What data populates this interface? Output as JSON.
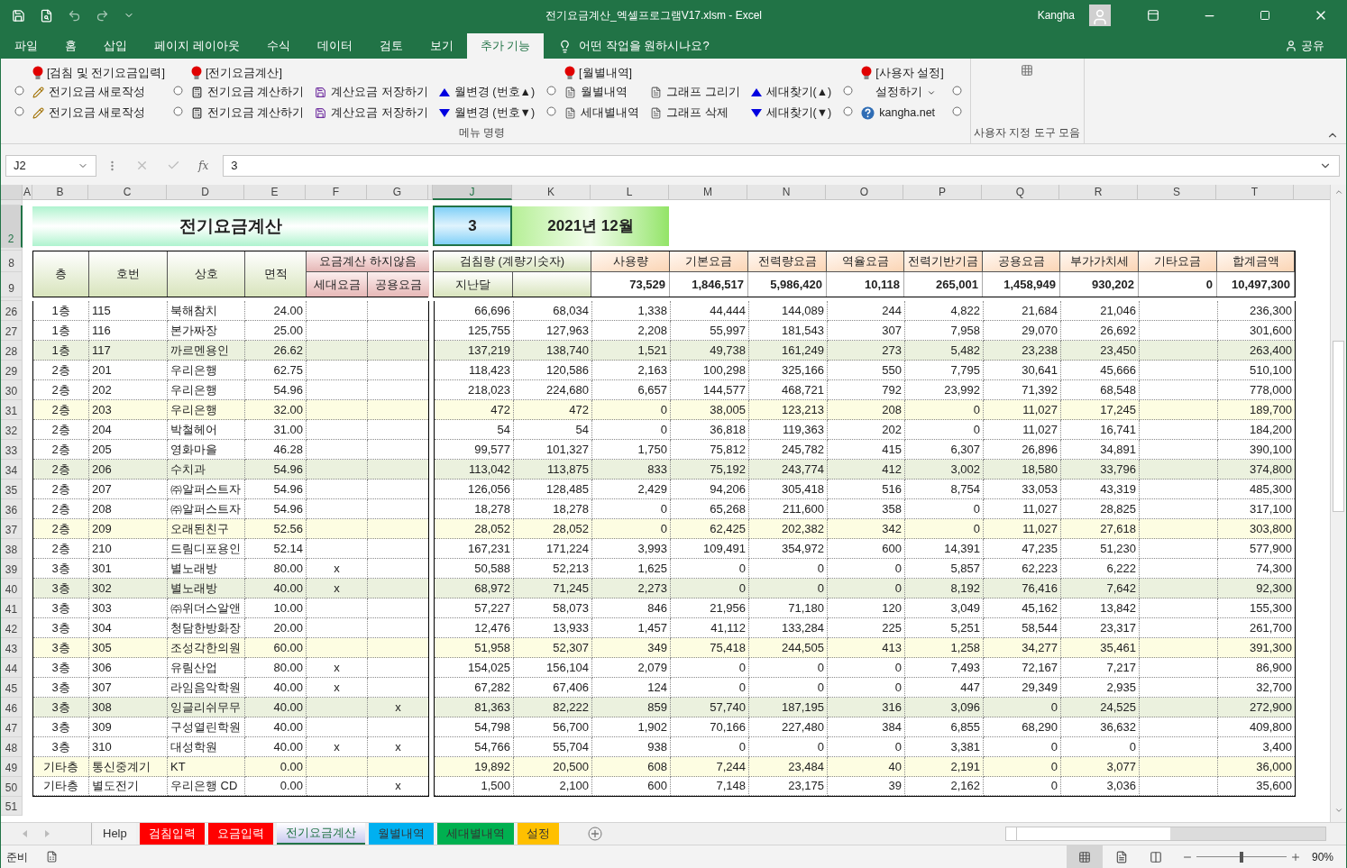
{
  "window": {
    "title": "전기요금계산_엑셀프로그램V17.xlsm  -  Excel",
    "user": "Kangha"
  },
  "ribbon_tabs": [
    {
      "label": "파일",
      "selected": false
    },
    {
      "label": "홈",
      "selected": false
    },
    {
      "label": "삽입",
      "selected": false
    },
    {
      "label": "페이지 레이아웃",
      "selected": false
    },
    {
      "label": "수식",
      "selected": false
    },
    {
      "label": "데이터",
      "selected": false
    },
    {
      "label": "검토",
      "selected": false
    },
    {
      "label": "보기",
      "selected": false
    },
    {
      "label": "추가 기능",
      "selected": true
    }
  ],
  "tell_me": "어떤 작업을 원하시나요?",
  "share": "공유",
  "ribbon": {
    "group_label": "메뉴 명령",
    "toolbar_label": "사용자 지정 도구 모음",
    "columns": [
      {
        "kind": "radios"
      },
      {
        "kind": "buttons",
        "header": "[검침 및 전기요금입력]",
        "items": [
          {
            "kind": "pencil",
            "label": "전기요금 새로작성"
          },
          {
            "kind": "pencil",
            "label": "전기요금 새로작성"
          }
        ]
      },
      {
        "kind": "radios"
      },
      {
        "kind": "buttons",
        "header": "[전기요금계산]",
        "items": [
          {
            "kind": "calculator",
            "label": "전기요금 계산하기"
          },
          {
            "kind": "calculator",
            "label": "전기요금 계산하기"
          }
        ]
      },
      {
        "kind": "buttons",
        "items": [
          {
            "kind": "save",
            "label": "계산요금 저장하기"
          },
          {
            "kind": "save",
            "label": "계산요금 저장하기"
          }
        ]
      },
      {
        "kind": "buttons",
        "items": [
          {
            "kind": "up",
            "label": "월변경 (번호▲)"
          },
          {
            "kind": "down",
            "label": "월변경 (번호▼)"
          }
        ]
      },
      {
        "kind": "radios"
      },
      {
        "kind": "buttons",
        "header": "[월별내역]",
        "items": [
          {
            "kind": "doc",
            "label": "월별내역"
          },
          {
            "kind": "doc",
            "label": "세대별내역"
          }
        ]
      },
      {
        "kind": "buttons",
        "items": [
          {
            "kind": "doc",
            "label": "그래프 그리기"
          },
          {
            "kind": "doc",
            "label": "그래프 삭제"
          }
        ]
      },
      {
        "kind": "buttons",
        "items": [
          {
            "kind": "up",
            "label": "세대찾기(▲)"
          },
          {
            "kind": "down",
            "label": "세대찾기(▼)"
          }
        ]
      },
      {
        "kind": "radios"
      },
      {
        "kind": "buttons",
        "header": "[사용자 설정]",
        "items": [
          {
            "kind": "dropdown",
            "label": "설정하기"
          },
          {
            "kind": "help",
            "label": "kangha.net"
          }
        ]
      },
      {
        "kind": "radios"
      }
    ]
  },
  "formula_bar": {
    "name_box": "J2",
    "function_label": "fx",
    "value": "3"
  },
  "columns": [
    {
      "label": "A",
      "selected": false
    },
    {
      "label": "B",
      "selected": false
    },
    {
      "label": "C",
      "selected": false
    },
    {
      "label": "D",
      "selected": false
    },
    {
      "label": "E",
      "selected": false
    },
    {
      "label": "F",
      "selected": false
    },
    {
      "label": "G",
      "selected": false
    },
    {
      "label": "J",
      "selected": true
    },
    {
      "label": "K",
      "selected": false
    },
    {
      "label": "L",
      "selected": false
    },
    {
      "label": "M",
      "selected": false
    },
    {
      "label": "N",
      "selected": false
    },
    {
      "label": "O",
      "selected": false
    },
    {
      "label": "P",
      "selected": false
    },
    {
      "label": "Q",
      "selected": false
    },
    {
      "label": "R",
      "selected": false
    },
    {
      "label": "S",
      "selected": false
    },
    {
      "label": "T",
      "selected": false
    }
  ],
  "title_row": {
    "row": "2",
    "selected": true,
    "title": "전기요금계산",
    "active_cell": "3",
    "month": "2021년 12월"
  },
  "header": {
    "rows": [
      "8",
      "9"
    ],
    "left": [
      "층",
      "호번",
      "상호",
      "면적"
    ],
    "exclude": "요금계산 하지않음",
    "exclude_sub": [
      "세대요금",
      "공용요금"
    ],
    "meter": "검침량 (계량기숫자)",
    "last_month": "지난달",
    "columns": [
      {
        "label": "사용량",
        "total": "73,529"
      },
      {
        "label": "기본요금",
        "total": "1,846,517"
      },
      {
        "label": "전력량요금",
        "total": "5,986,420"
      },
      {
        "label": "역율요금",
        "total": "10,118"
      },
      {
        "label": "전력기반기금",
        "total": "265,001"
      },
      {
        "label": "공용요금",
        "total": "1,458,949"
      },
      {
        "label": "부가가치세",
        "total": "930,202"
      },
      {
        "label": "기타요금",
        "total": "0"
      },
      {
        "label": "합계금액",
        "total": "10,497,300"
      }
    ]
  },
  "rows": [
    {
      "row": "26",
      "selected": false,
      "color": "#ffffff",
      "floor": "1층",
      "unit": "115",
      "name": "북해참치",
      "area": "24.00",
      "values": [
        "66,696",
        "68,034",
        "1,338",
        "44,444",
        "144,089",
        "244",
        "4,822",
        "21,684",
        "21,046"
      ],
      "total": "236,300"
    },
    {
      "row": "27",
      "selected": false,
      "color": "#ffffff",
      "floor": "1층",
      "unit": "116",
      "name": "본가짜장",
      "area": "25.00",
      "values": [
        "125,755",
        "127,963",
        "2,208",
        "55,997",
        "181,543",
        "307",
        "7,958",
        "29,070",
        "26,692"
      ],
      "total": "301,600"
    },
    {
      "row": "28",
      "selected": false,
      "color": "#ebf1de",
      "floor": "1층",
      "unit": "117",
      "name": "까르멘용인",
      "area": "26.62",
      "values": [
        "137,219",
        "138,740",
        "1,521",
        "49,738",
        "161,249",
        "273",
        "5,482",
        "23,238",
        "23,450"
      ],
      "total": "263,400"
    },
    {
      "row": "29",
      "selected": false,
      "color": "#ffffff",
      "floor": "2층",
      "unit": "201",
      "name": "우리은행",
      "area": "62.75",
      "values": [
        "118,423",
        "120,586",
        "2,163",
        "100,298",
        "325,166",
        "550",
        "7,795",
        "30,641",
        "45,666"
      ],
      "total": "510,100"
    },
    {
      "row": "30",
      "selected": false,
      "color": "#ffffff",
      "floor": "2층",
      "unit": "202",
      "name": "우리은행",
      "area": "54.96",
      "values": [
        "218,023",
        "224,680",
        "6,657",
        "144,577",
        "468,721",
        "792",
        "23,992",
        "71,392",
        "68,548"
      ],
      "total": "778,000"
    },
    {
      "row": "31",
      "selected": false,
      "color": "#fdfde2",
      "floor": "2층",
      "unit": "203",
      "name": "우리은행",
      "area": "32.00",
      "values": [
        "472",
        "472",
        "0",
        "38,005",
        "123,213",
        "208",
        "0",
        "11,027",
        "17,245"
      ],
      "total": "189,700"
    },
    {
      "row": "32",
      "selected": false,
      "color": "#ffffff",
      "floor": "2층",
      "unit": "204",
      "name": "박철헤어",
      "area": "31.00",
      "values": [
        "54",
        "54",
        "0",
        "36,818",
        "119,363",
        "202",
        "0",
        "11,027",
        "16,741"
      ],
      "total": "184,200"
    },
    {
      "row": "33",
      "selected": false,
      "color": "#ffffff",
      "floor": "2층",
      "unit": "205",
      "name": "영화마을",
      "area": "46.28",
      "values": [
        "99,577",
        "101,327",
        "1,750",
        "75,812",
        "245,782",
        "415",
        "6,307",
        "26,896",
        "34,891"
      ],
      "total": "390,100"
    },
    {
      "row": "34",
      "selected": false,
      "color": "#ebf1de",
      "floor": "2층",
      "unit": "206",
      "name": "수치과",
      "area": "54.96",
      "values": [
        "113,042",
        "113,875",
        "833",
        "75,192",
        "243,774",
        "412",
        "3,002",
        "18,580",
        "33,796"
      ],
      "total": "374,800"
    },
    {
      "row": "35",
      "selected": false,
      "color": "#ffffff",
      "floor": "2층",
      "unit": "207",
      "name": "㈜알퍼스트자",
      "area": "54.96",
      "values": [
        "126,056",
        "128,485",
        "2,429",
        "94,206",
        "305,418",
        "516",
        "8,754",
        "33,053",
        "43,319"
      ],
      "total": "485,300"
    },
    {
      "row": "36",
      "selected": false,
      "color": "#ffffff",
      "floor": "2층",
      "unit": "208",
      "name": "㈜알퍼스트자",
      "area": "54.96",
      "values": [
        "18,278",
        "18,278",
        "0",
        "65,268",
        "211,600",
        "358",
        "0",
        "11,027",
        "28,825"
      ],
      "total": "317,100"
    },
    {
      "row": "37",
      "selected": false,
      "color": "#fdfde2",
      "floor": "2층",
      "unit": "209",
      "name": "오래된친구",
      "area": "52.56",
      "values": [
        "28,052",
        "28,052",
        "0",
        "62,425",
        "202,382",
        "342",
        "0",
        "11,027",
        "27,618"
      ],
      "total": "303,800"
    },
    {
      "row": "38",
      "selected": false,
      "color": "#ffffff",
      "floor": "2층",
      "unit": "210",
      "name": "드림디포용인",
      "area": "52.14",
      "values": [
        "167,231",
        "171,224",
        "3,993",
        "109,491",
        "354,972",
        "600",
        "14,391",
        "47,235",
        "51,230"
      ],
      "total": "577,900"
    },
    {
      "row": "39",
      "selected": false,
      "color": "#ffffff",
      "floor": "3층",
      "unit": "301",
      "name": "별노래방",
      "area": "80.00",
      "no_unit_fee": "x",
      "values": [
        "50,588",
        "52,213",
        "1,625",
        "0",
        "0",
        "0",
        "5,857",
        "62,223",
        "6,222"
      ],
      "total": "74,300"
    },
    {
      "row": "40",
      "selected": false,
      "color": "#ebf1de",
      "floor": "3층",
      "unit": "302",
      "name": "별노래방",
      "area": "40.00",
      "no_unit_fee": "x",
      "values": [
        "68,972",
        "71,245",
        "2,273",
        "0",
        "0",
        "0",
        "8,192",
        "76,416",
        "7,642"
      ],
      "total": "92,300"
    },
    {
      "row": "41",
      "selected": false,
      "color": "#ffffff",
      "floor": "3층",
      "unit": "303",
      "name": "㈜위더스알앤",
      "area": "10.00",
      "values": [
        "57,227",
        "58,073",
        "846",
        "21,956",
        "71,180",
        "120",
        "3,049",
        "45,162",
        "13,842"
      ],
      "total": "155,300"
    },
    {
      "row": "42",
      "selected": false,
      "color": "#ffffff",
      "floor": "3층",
      "unit": "304",
      "name": "청담한방화장",
      "area": "20.00",
      "values": [
        "12,476",
        "13,933",
        "1,457",
        "41,112",
        "133,284",
        "225",
        "5,251",
        "58,544",
        "23,317"
      ],
      "total": "261,700"
    },
    {
      "row": "43",
      "selected": false,
      "color": "#fdfde2",
      "floor": "3층",
      "unit": "305",
      "name": "조성각한의원",
      "area": "60.00",
      "values": [
        "51,958",
        "52,307",
        "349",
        "75,418",
        "244,505",
        "413",
        "1,258",
        "34,277",
        "35,461"
      ],
      "total": "391,300"
    },
    {
      "row": "44",
      "selected": false,
      "color": "#ffffff",
      "floor": "3층",
      "unit": "306",
      "name": "유림산업",
      "area": "80.00",
      "no_unit_fee": "x",
      "values": [
        "154,025",
        "156,104",
        "2,079",
        "0",
        "0",
        "0",
        "7,493",
        "72,167",
        "7,217"
      ],
      "total": "86,900"
    },
    {
      "row": "45",
      "selected": false,
      "color": "#ffffff",
      "floor": "3층",
      "unit": "307",
      "name": "라임음악학원",
      "area": "40.00",
      "no_unit_fee": "x",
      "values": [
        "67,282",
        "67,406",
        "124",
        "0",
        "0",
        "0",
        "447",
        "29,349",
        "2,935"
      ],
      "total": "32,700"
    },
    {
      "row": "46",
      "selected": false,
      "color": "#ebf1de",
      "floor": "3층",
      "unit": "308",
      "name": "잉글리쉬무무",
      "area": "40.00",
      "no_common_fee": "x",
      "values": [
        "81,363",
        "82,222",
        "859",
        "57,740",
        "187,195",
        "316",
        "3,096",
        "0",
        "24,525"
      ],
      "total": "272,900"
    },
    {
      "row": "47",
      "selected": false,
      "color": "#ffffff",
      "floor": "3층",
      "unit": "309",
      "name": "구성열린학원",
      "area": "40.00",
      "values": [
        "54,798",
        "56,700",
        "1,902",
        "70,166",
        "227,480",
        "384",
        "6,855",
        "68,290",
        "36,632"
      ],
      "total": "409,800"
    },
    {
      "row": "48",
      "selected": false,
      "color": "#ffffff",
      "floor": "3층",
      "unit": "310",
      "name": "대성학원",
      "area": "40.00",
      "no_unit_fee": "x",
      "no_common_fee": "x",
      "values": [
        "54,766",
        "55,704",
        "938",
        "0",
        "0",
        "0",
        "3,381",
        "0",
        "0"
      ],
      "total": "3,400"
    },
    {
      "row": "49",
      "selected": false,
      "color": "#fdfde2",
      "floor": "기타층",
      "unit": "통신중계기",
      "name": "KT",
      "area": "0.00",
      "values": [
        "19,892",
        "20,500",
        "608",
        "7,244",
        "23,484",
        "40",
        "2,191",
        "0",
        "3,077"
      ],
      "total": "36,000"
    },
    {
      "row": "50",
      "selected": false,
      "color": "#ffffff",
      "floor": "기타층",
      "unit": "별도전기",
      "name": "우리은행 CD",
      "area": "0.00",
      "no_common_fee": "x",
      "values": [
        "1,500",
        "2,100",
        "600",
        "7,148",
        "23,175",
        "39",
        "2,162",
        "0",
        "3,036"
      ],
      "total": "35,600"
    }
  ],
  "last_row": "51",
  "sheet_tabs": [
    {
      "label": "Help",
      "color": "#f3f3f3",
      "selected": false
    },
    {
      "label": "검침입력",
      "color": "#ff0000",
      "selected": false
    },
    {
      "label": "요금입력",
      "color": "#ff0000",
      "selected": false
    },
    {
      "label": "전기요금계산",
      "color": "#c9c9f0",
      "selected": true
    },
    {
      "label": "월별내역",
      "color": "#00b0f0",
      "selected": false
    },
    {
      "label": "세대별내역",
      "color": "#00b050",
      "selected": false
    },
    {
      "label": "설정",
      "color": "#ffc000",
      "selected": false
    }
  ],
  "status": {
    "text": "준비",
    "zoom": "90%",
    "zoom_slider": {
      "level": 0.5
    }
  }
}
